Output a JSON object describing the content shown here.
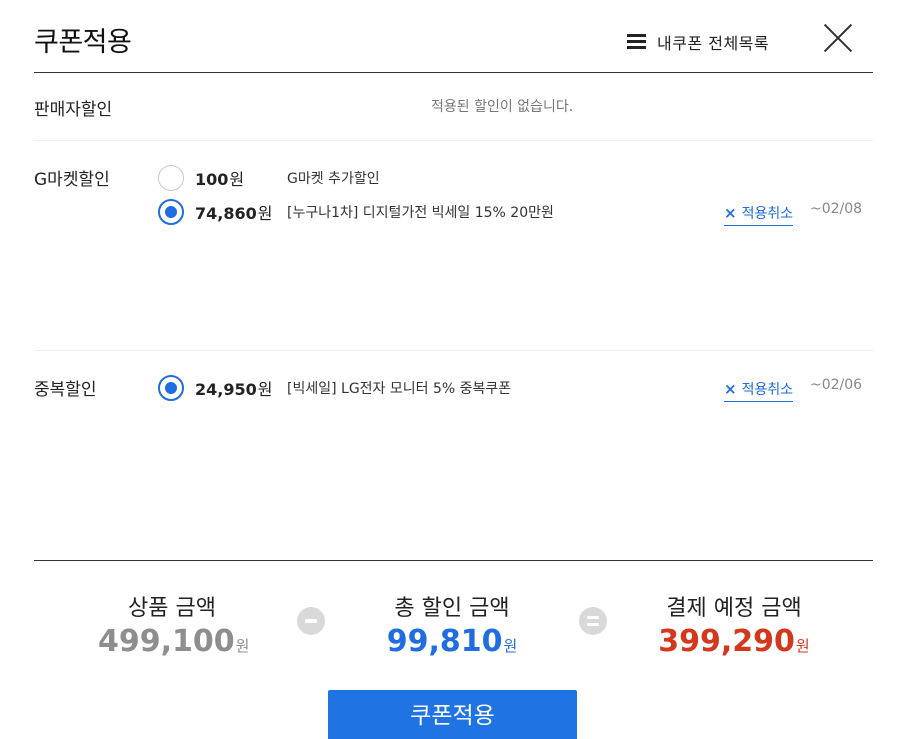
{
  "header": {
    "title": "쿠폰적용",
    "my_coupon_link": "내쿠폰 전체목록",
    "menu_icon": "hamburger-icon",
    "close_icon": "close-icon"
  },
  "seller": {
    "label": "판매자할인",
    "empty_text": "적용된 할인이 없습니다."
  },
  "gmarket": {
    "label": "G마켓할인",
    "coupons": [
      {
        "amount": "100",
        "unit": "원",
        "desc": "G마켓 추가할인",
        "checked": false
      },
      {
        "amount": "74,860",
        "unit": "원",
        "desc": "[누구나1차] 디지털가전 빅세일 15% 20만원",
        "checked": true,
        "cancel": "적용취소",
        "expire": "~02/08"
      }
    ]
  },
  "duplicate": {
    "label": "중복할인",
    "coupons": [
      {
        "amount": "24,950",
        "unit": "원",
        "desc": "[빅세일] LG전자 모니터 5% 중복쿠폰",
        "checked": true,
        "cancel": "적용취소",
        "expire": "~02/06"
      }
    ]
  },
  "summary": {
    "product_label": "상품 금액",
    "product_value": "499,100",
    "discount_label": "총 할인 금액",
    "discount_value": "99,810",
    "final_label": "결제 예정 금액",
    "final_value": "399,290",
    "unit": "원",
    "minus_icon": "minus-circle-icon",
    "equals_icon": "equals-circle-icon"
  },
  "apply_button": "쿠폰적용",
  "colors": {
    "accent": "#1f6de0",
    "final_amount": "#d3381c",
    "product_amount": "#8e8e8e"
  }
}
